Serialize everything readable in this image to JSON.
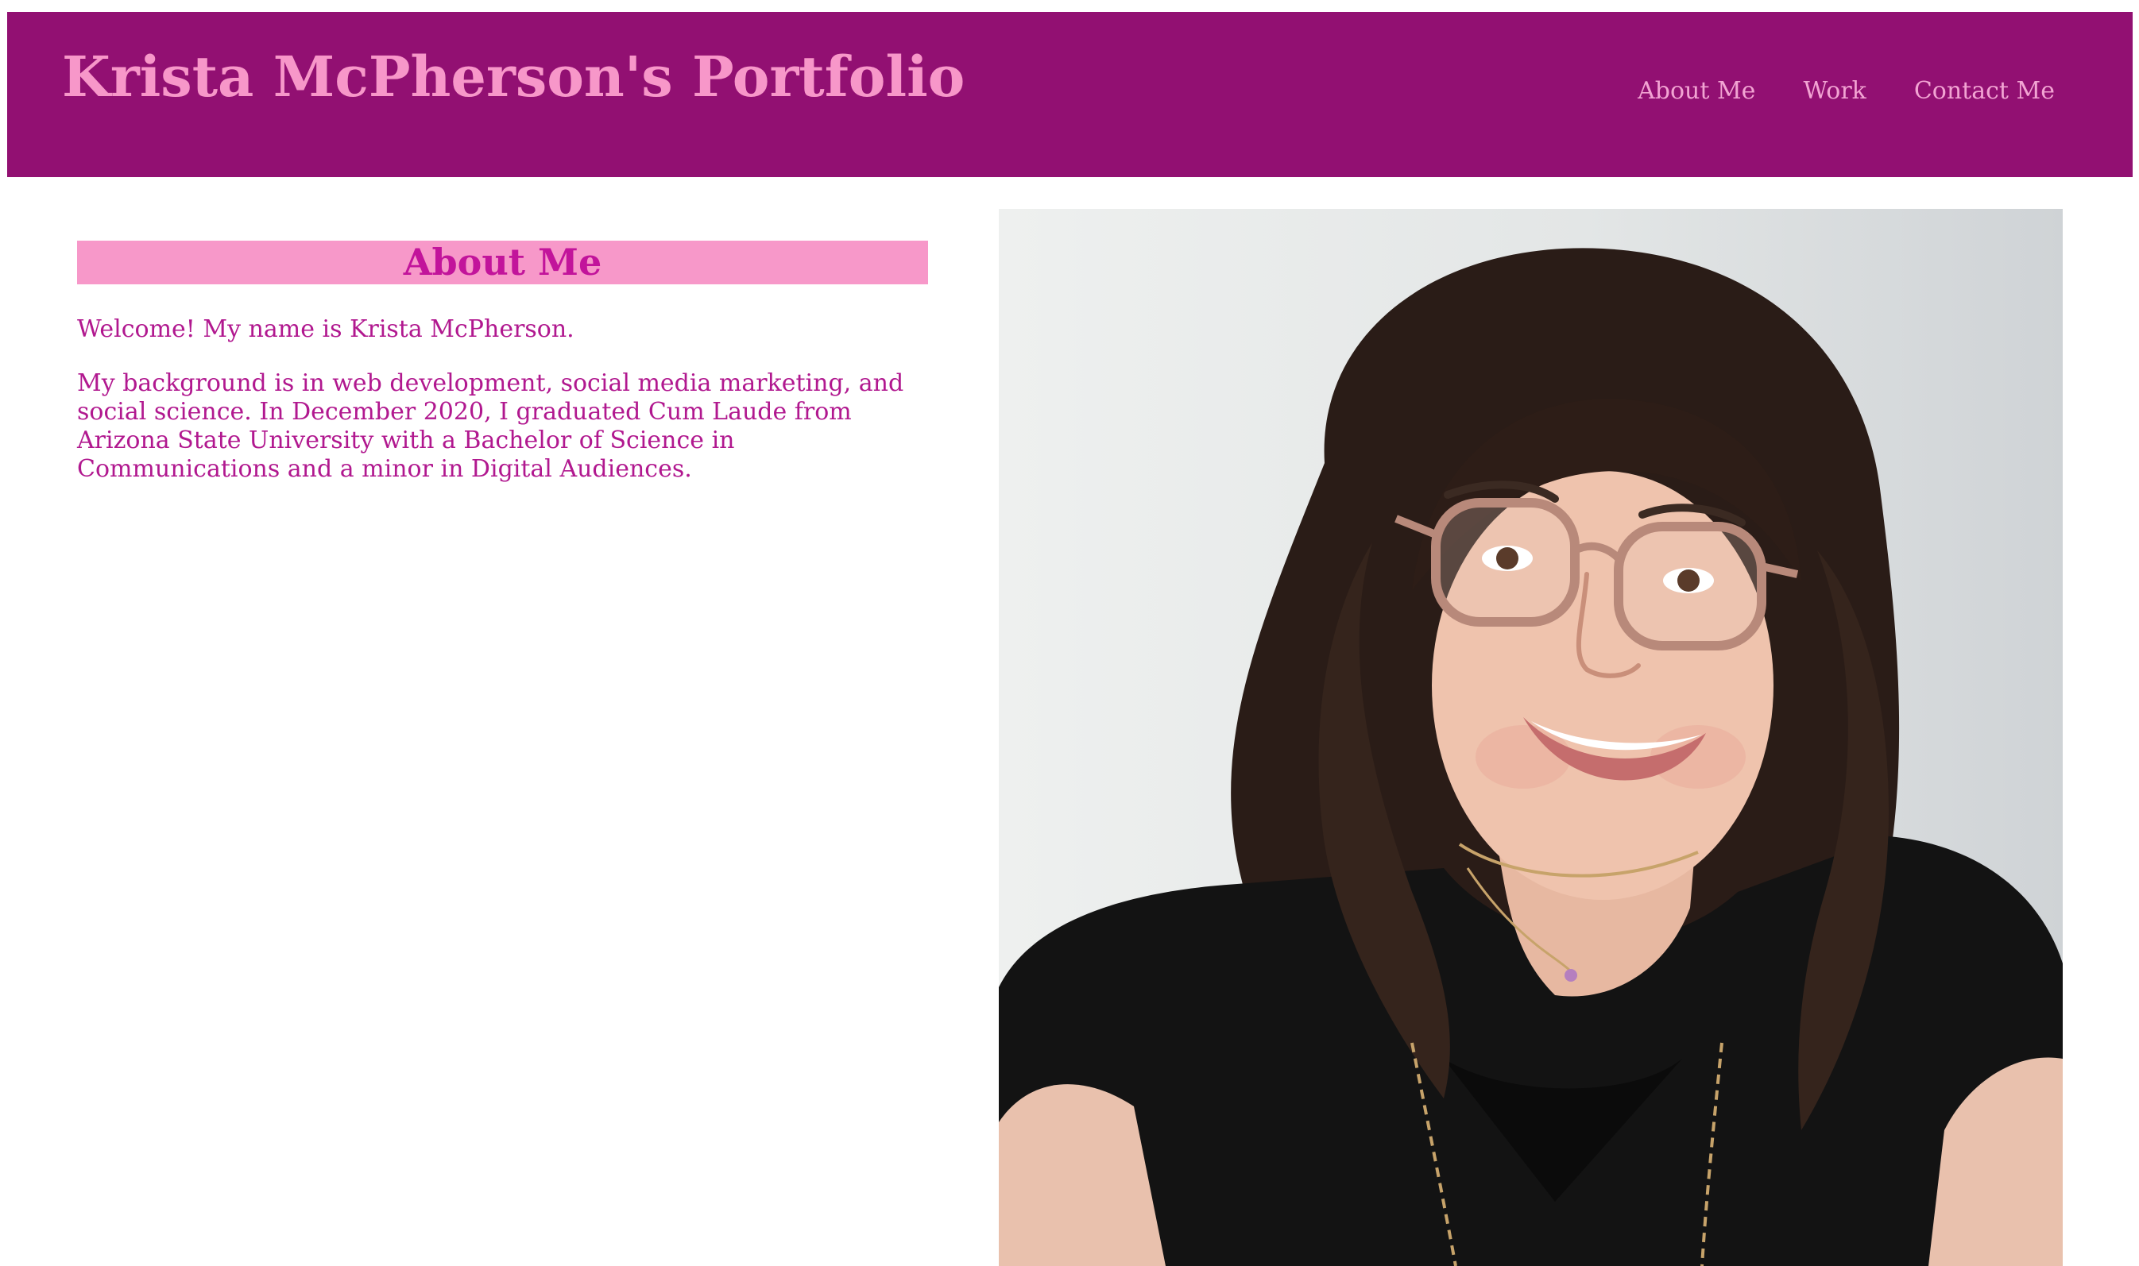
{
  "header": {
    "title": "Krista McPherson's Portfolio",
    "nav": [
      {
        "label": "About Me"
      },
      {
        "label": "Work"
      },
      {
        "label": "Contact Me"
      }
    ]
  },
  "about": {
    "heading": "About Me",
    "intro": "Welcome! My name is Krista McPherson.",
    "bio": "My background is in web development, social media marketing, and social science. In December 2020, I graduated Cum Laude from Arizona State University with a Bachelor of Science in Communications and a minor in Digital Audiences."
  },
  "colors": {
    "header_bg": "#921072",
    "title_pink": "#f797c9",
    "heading_bar": "#f798c9",
    "text_magenta": "#b1188f"
  }
}
